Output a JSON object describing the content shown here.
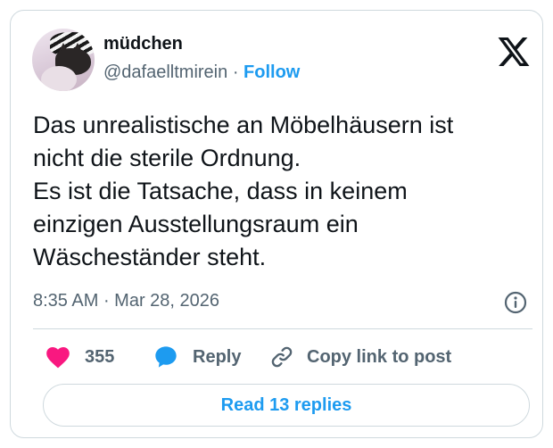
{
  "author": {
    "display_name": "müdchen",
    "handle": "@dafaelltmirein",
    "follow_label": "Follow",
    "separator": "·"
  },
  "tweet": {
    "lines": [
      "Das unrealistische an Möbelhäusern ist",
      "nicht die sterile Ordnung.",
      "Es ist die Tatsache, dass in keinem",
      "einzigen Ausstellungsraum ein",
      "Wäscheständer steht."
    ],
    "time": "8:35 AM",
    "date": "Mar 28, 2026",
    "separator": "·"
  },
  "actions": {
    "like_count": "355",
    "reply_label": "Reply",
    "copy_label": "Copy link to post"
  },
  "read_replies_label": "Read 13 replies",
  "icons": {
    "logo": "x-logo-icon",
    "info": "info-icon",
    "like": "heart-icon",
    "reply": "reply-bubble-icon",
    "copy": "link-icon"
  },
  "colors": {
    "accent": "#1d9bf0",
    "like": "#f91880",
    "secondary_text": "#536471",
    "border": "#cfd9de"
  }
}
